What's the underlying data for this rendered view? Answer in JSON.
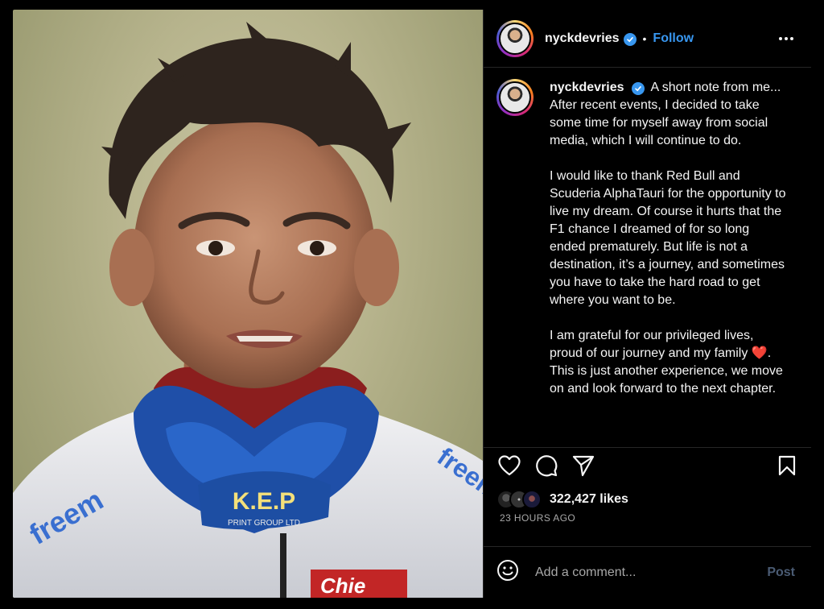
{
  "post": {
    "image_alt": "Young driver in white racing suit with blue collar",
    "collar_text": "K.E.P",
    "collar_subtext": "PRINT GROUP LTD",
    "sleeve_text": "freem",
    "sleeve_text_right": "freem",
    "chest_text": "Chie"
  },
  "header": {
    "username": "nyckdevries",
    "separator": "•",
    "follow_label": "Follow"
  },
  "caption": {
    "username": "nyckdevries",
    "paragraph1": "A short note from me... After recent events, I decided to take some time for myself away from social media, which I will continue to do.",
    "paragraph2": "I would like to thank Red Bull and Scuderia AlphaTauri for the opportunity to live my dream. Of course it hurts that the F1 chance I dreamed of for so long ended prematurely. But life is not a destination, it’s a journey, and sometimes you have to take the hard road to get where you want to be.",
    "paragraph3_a": "I am grateful for our privileged lives, proud of our journey and my family ",
    "paragraph3_emoji": "❤️",
    "paragraph3_b": ". This is just another experience, we move on and look forward to the next chapter."
  },
  "engagement": {
    "likes": "322,427 likes",
    "time": "23 HOURS AGO"
  },
  "comment": {
    "placeholder": "Add a comment...",
    "post_label": "Post"
  },
  "colors": {
    "accent": "#3897f0",
    "background": "#000000",
    "muted": "#a8a8a8",
    "post_disabled": "#4a5b73"
  }
}
